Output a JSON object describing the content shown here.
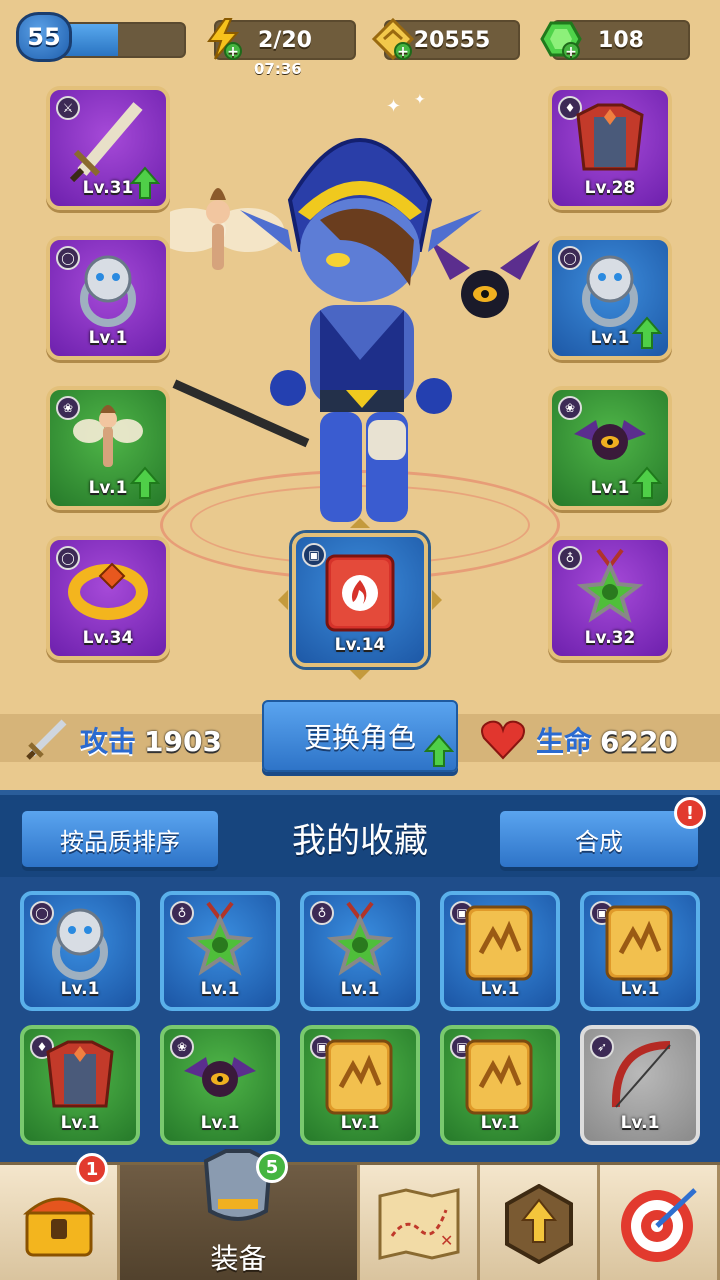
{
  "player": {
    "level": "55",
    "xp_fraction": 0.48
  },
  "resources": {
    "energy": "2/20",
    "energy_timer": "07:36",
    "gold": "20555",
    "gems": "108"
  },
  "equipment": {
    "left": [
      {
        "name": "weapon",
        "level": "Lv.31",
        "rarity": "purple",
        "upgradable": true
      },
      {
        "name": "ring",
        "level": "Lv.1",
        "rarity": "purple",
        "upgradable": false
      },
      {
        "name": "pet",
        "level": "Lv.1",
        "rarity": "green",
        "upgradable": true
      },
      {
        "name": "bracelet",
        "level": "Lv.34",
        "rarity": "purple",
        "upgradable": false
      }
    ],
    "right": [
      {
        "name": "armor",
        "level": "Lv.28",
        "rarity": "purple",
        "upgradable": false
      },
      {
        "name": "ring",
        "level": "Lv.1",
        "rarity": "blue",
        "upgradable": true
      },
      {
        "name": "pet",
        "level": "Lv.1",
        "rarity": "green",
        "upgradable": true
      },
      {
        "name": "amulet",
        "level": "Lv.32",
        "rarity": "purple",
        "upgradable": false
      }
    ],
    "spellbook": {
      "level": "Lv.14"
    }
  },
  "stats": {
    "attack_label": "攻击",
    "attack_value": "1903",
    "hp_label": "生命",
    "hp_value": "6220",
    "change_hero": "更换角色"
  },
  "collection": {
    "sort_label": "按品质排序",
    "title": "我的收藏",
    "craft_label": "合成",
    "craft_alert": "!",
    "items": [
      {
        "type": "ring",
        "level": "Lv.1",
        "rarity": "blue"
      },
      {
        "type": "amulet",
        "level": "Lv.1",
        "rarity": "blue"
      },
      {
        "type": "amulet",
        "level": "Lv.1",
        "rarity": "blue"
      },
      {
        "type": "book",
        "level": "Lv.1",
        "rarity": "blue"
      },
      {
        "type": "book",
        "level": "Lv.1",
        "rarity": "blue"
      },
      {
        "type": "armor",
        "level": "Lv.1",
        "rarity": "green"
      },
      {
        "type": "pet",
        "level": "Lv.1",
        "rarity": "green"
      },
      {
        "type": "book",
        "level": "Lv.1",
        "rarity": "green"
      },
      {
        "type": "book",
        "level": "Lv.1",
        "rarity": "green"
      },
      {
        "type": "bow",
        "level": "Lv.1",
        "rarity": "gray"
      }
    ]
  },
  "nav": {
    "chest_badge": "1",
    "equip_badge": "5",
    "equip_label": "装备",
    "icons": [
      "chest-icon",
      "armor-icon",
      "map-icon",
      "upgrade-icon",
      "target-icon"
    ]
  }
}
